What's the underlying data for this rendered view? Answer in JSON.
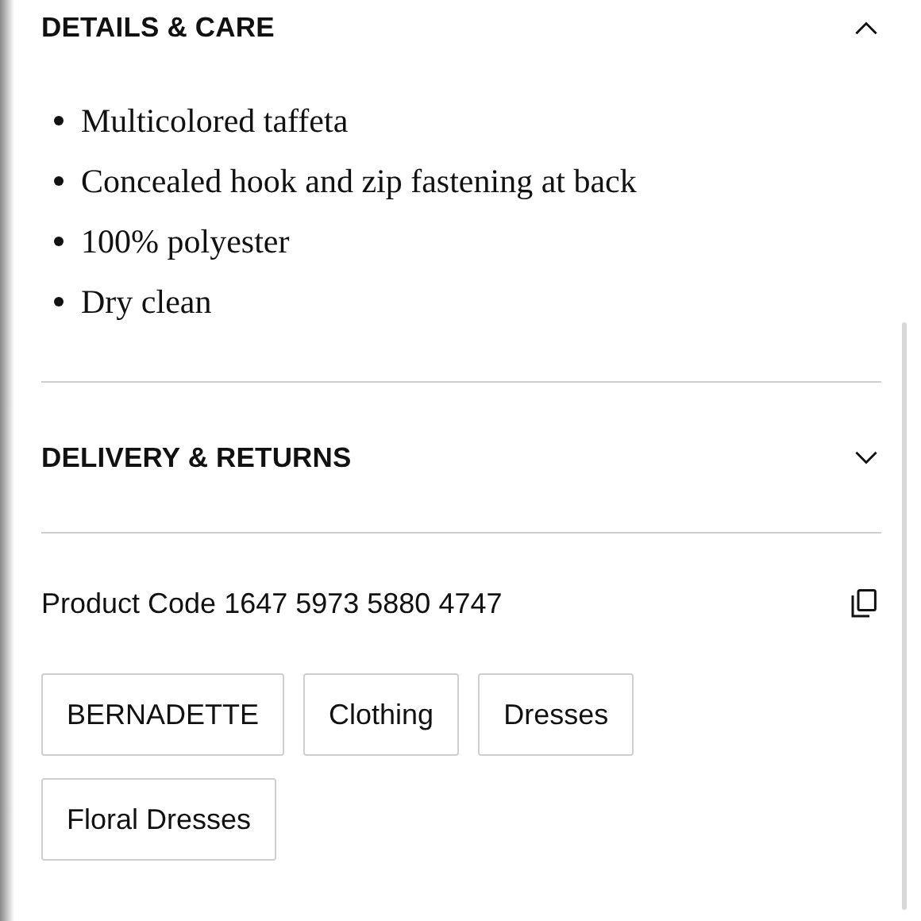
{
  "sections": [
    {
      "title": "DETAILS & CARE",
      "expanded": true,
      "items": [
        "Multicolored taffeta",
        "Concealed hook and zip fastening at back",
        "100% polyester",
        "Dry clean"
      ]
    },
    {
      "title": "DELIVERY & RETURNS",
      "expanded": false
    }
  ],
  "product_code": "Product Code 1647 5973 5880 4747",
  "tags": [
    "BERNADETTE",
    "Clothing",
    "Dresses",
    "Floral Dresses"
  ]
}
